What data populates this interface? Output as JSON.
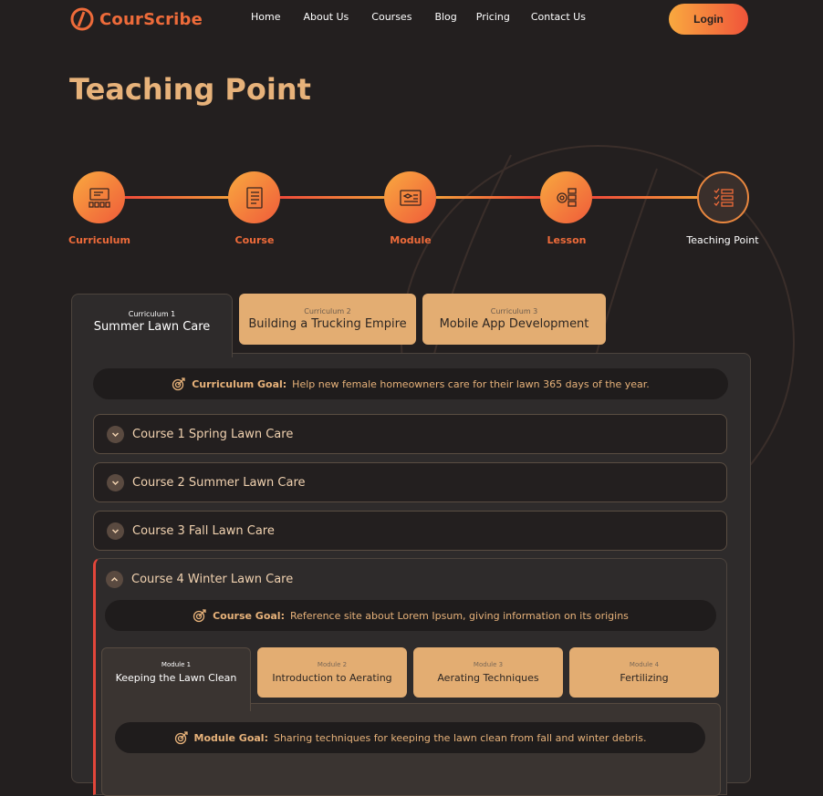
{
  "header": {
    "brand": "CourScribe",
    "nav": [
      "Home",
      "About Us",
      "Courses",
      "Blog",
      "Pricing",
      "Contact Us"
    ],
    "login_label": "Login"
  },
  "page": {
    "title": "Teaching Point"
  },
  "stepper": {
    "steps": [
      {
        "label": "Curriculum",
        "icon": "curriculum-icon"
      },
      {
        "label": "Course",
        "icon": "course-icon"
      },
      {
        "label": "Module",
        "icon": "module-icon"
      },
      {
        "label": "Lesson",
        "icon": "lesson-icon"
      },
      {
        "label": "Teaching Point",
        "icon": "teaching-point-icon"
      }
    ],
    "active_index": 4
  },
  "curricula": [
    {
      "sub": "Curriculum 1",
      "title": "Summer Lawn Care",
      "active": true
    },
    {
      "sub": "Curriculum 2",
      "title": "Building a Trucking Empire",
      "active": false
    },
    {
      "sub": "Curriculum 3",
      "title": "Mobile App Development",
      "active": false
    }
  ],
  "curriculum_goal": {
    "label": "Curriculum Goal:",
    "text": "Help new female homeowners care for their lawn 365 days of the year."
  },
  "courses": [
    {
      "title": "Course 1 Spring Lawn Care",
      "expanded": false
    },
    {
      "title": "Course 2 Summer Lawn Care",
      "expanded": false
    },
    {
      "title": "Course 3 Fall Lawn Care",
      "expanded": false
    },
    {
      "title": "Course 4 Winter Lawn Care",
      "expanded": true
    }
  ],
  "course_goal": {
    "label": "Course Goal:",
    "text": "Reference site about Lorem Ipsum, giving information on its origins"
  },
  "modules": [
    {
      "sub": "Module 1",
      "title": "Keeping the Lawn Clean",
      "active": true
    },
    {
      "sub": "Module 2",
      "title": "Introduction to Aerating",
      "active": false
    },
    {
      "sub": "Module 3",
      "title": "Aerating Techniques",
      "active": false
    },
    {
      "sub": "Module 4",
      "title": "Fertilizing",
      "active": false
    }
  ],
  "module_goal": {
    "label": "Module Goal:",
    "text": "Sharing techniques for keeping the lawn clean from fall and winter debris."
  },
  "colors": {
    "background": "#231f1f",
    "accent": "#ee6b3a",
    "tab_inactive": "#e3ad72",
    "title": "#e7b27a"
  }
}
